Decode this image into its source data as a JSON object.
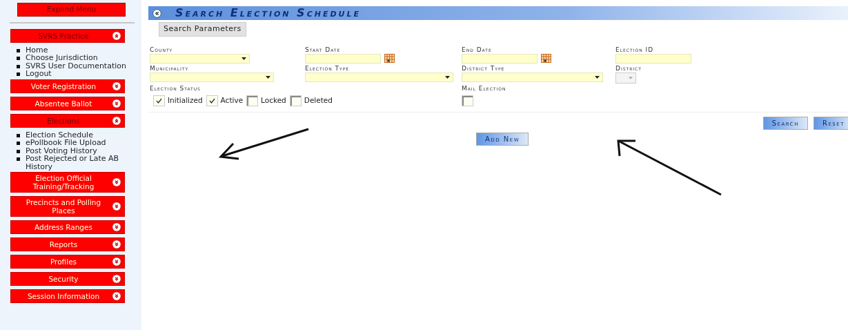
{
  "sidebar": {
    "expand_button": "Expand Menu",
    "sections": [
      {
        "label": "SVRS Practice",
        "expanded": true,
        "items": [
          "Home",
          "Choose Jurisdiction",
          "SVRS User Documentation",
          "Logout"
        ]
      },
      {
        "label": "Voter Registration",
        "expanded": false
      },
      {
        "label": "Absentee Ballot",
        "expanded": false
      },
      {
        "label": "Elections",
        "expanded": true,
        "items": [
          "Election Schedule",
          "ePollbook File Upload",
          "Post Voting History",
          "Post Rejected or Late AB History"
        ]
      },
      {
        "label": "Election Official Training/Tracking",
        "expanded": false
      },
      {
        "label": "Precincts and Polling Places",
        "expanded": false
      },
      {
        "label": "Address Ranges",
        "expanded": false
      },
      {
        "label": "Reports",
        "expanded": false
      },
      {
        "label": "Profiles",
        "expanded": false
      },
      {
        "label": "Security",
        "expanded": false
      },
      {
        "label": "Session Information",
        "expanded": false
      }
    ]
  },
  "page": {
    "title": "Search Election Schedule",
    "tab": "Search Parameters"
  },
  "fields": [
    {
      "kind": "select",
      "label": "County"
    },
    {
      "kind": "date",
      "label": "Start Date"
    },
    {
      "kind": "date",
      "label": "End Date"
    },
    {
      "kind": "text",
      "label": "Election ID"
    },
    {
      "kind": "select",
      "label": "Municipality"
    },
    {
      "kind": "select",
      "label": "Election Type"
    },
    {
      "kind": "select",
      "label": "District Type"
    },
    {
      "kind": "mini-select",
      "label": "District"
    }
  ],
  "election_status": {
    "label": "Election Status",
    "options": [
      {
        "label": "Initialized",
        "checked": true
      },
      {
        "label": "Active",
        "checked": true
      },
      {
        "label": "Locked",
        "checked": false
      },
      {
        "label": "Deleted",
        "checked": false
      }
    ]
  },
  "mail_election": {
    "label": "Mail Election",
    "checked": false
  },
  "buttons": [
    "Search",
    "Reset"
  ],
  "add_button": "Add New",
  "annotations": [
    {
      "kind": "arrow"
    },
    {
      "kind": "arrow"
    }
  ]
}
